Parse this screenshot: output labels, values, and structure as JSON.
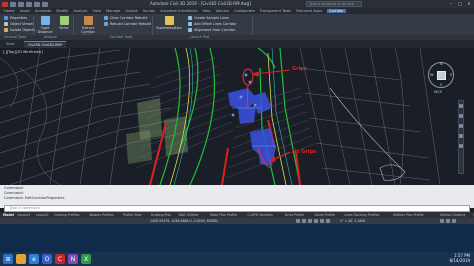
{
  "window": {
    "title": "Autodesk Civil 3D 2019 - [Civil3D Civil3D-RM.dwg]",
    "search_placeholder": "Type a keyword or phrase",
    "minimize": "–",
    "maximize": "□",
    "close": "✕"
  },
  "ribbon_tabs": [
    "Home",
    "Insert",
    "Annotate",
    "Modify",
    "Analyze",
    "View",
    "Manage",
    "Output",
    "Survey",
    "Autodesk InfraWorks",
    "Help",
    "Add-ins",
    "Collaborate",
    "Transparent Tools",
    "Featured Apps",
    "Corridor"
  ],
  "active_ribbon_tab": "Corridor",
  "ribbon": {
    "modify": [
      "Properties",
      "Object Viewer",
      "Isolate Objects"
    ],
    "analyze": [
      "Sight Distance",
      "Drive"
    ],
    "extract": "Extract Corridor Solids",
    "rebuild": [
      "Clear Corridor Rebuild",
      "Rebuild Corridor Rebuild"
    ],
    "supers": "Superelevation",
    "tools": [
      "Create Sample Lines",
      "Add Offset Lines Corridor",
      "Alignment from Corridor"
    ],
    "panels": [
      "General Tools",
      "Analyze",
      "Corridor Tools",
      "Launch Pad"
    ]
  },
  "doc_tabs": [
    "Start",
    "Civil3D Civil3D-RM*"
  ],
  "viewport_label": "[-][Top][2D Wireframe]",
  "annotations": [
    {
      "text": "Grips",
      "color": "#e02020"
    },
    {
      "text": "No Grips",
      "color": "#e02020"
    }
  ],
  "compass": {
    "n": "N",
    "s": "S",
    "e": "E",
    "w": "W",
    "wcs": "WCS"
  },
  "command": {
    "lines": [
      "Command:",
      "Command:",
      "Command:  EditCorridorProperties"
    ],
    "input_placeholder": "Type a command"
  },
  "layout_tabs": [
    "Model",
    "Layout1",
    "Layout2",
    "Grading Profiles",
    "Bowers Profiles",
    "Profile View",
    "Grading Plan",
    "Wall Utilities",
    "Road Plan Profile",
    "Cut/Fill Sections",
    "Drive Profile",
    "Storm Profile",
    "Lines Tracking Profiles",
    "Utilities Plan Profile",
    "Section Grading",
    "Sanitary Profiles",
    "Retaining Wall Profile"
  ],
  "active_layout_tab": "Model",
  "status": {
    "coords": "1400.52479, 1034.9684.0, 0.0000, MODEL",
    "scale": "1\" = 40'  1.1000"
  },
  "taskbar": {
    "clock": "1:57 PM",
    "date": "8/14/2019"
  },
  "colors": {
    "accent": "#3d6fb0",
    "grips_red": "#e02020",
    "corridor_blue": "#3a52e0",
    "green": "#1fbf3a"
  }
}
